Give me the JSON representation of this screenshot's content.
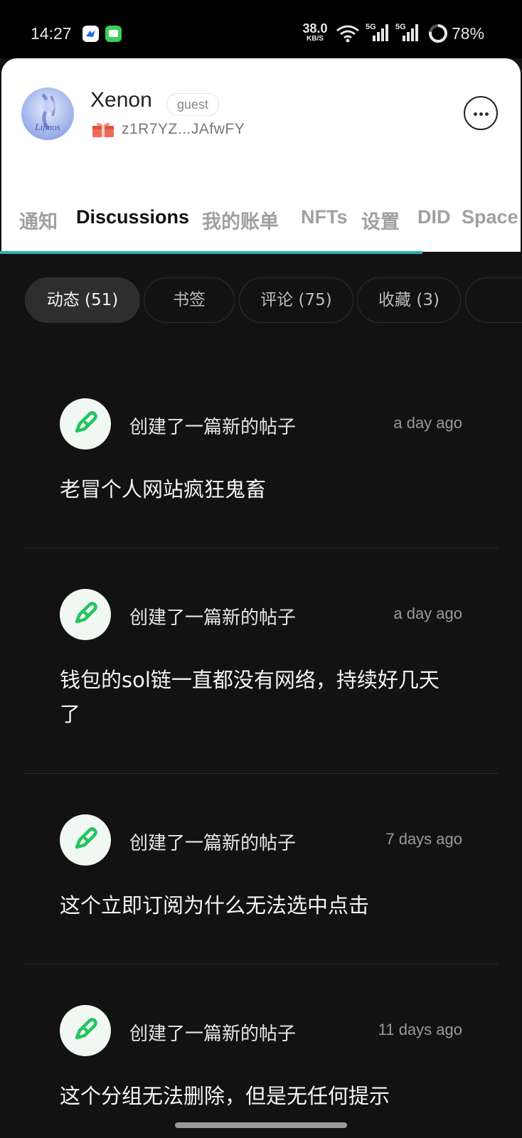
{
  "status_bar": {
    "time": "14:27",
    "net_speed_value": "38.0",
    "net_speed_unit": "KB/S",
    "signal_1_label": "5G",
    "signal_2_label": "5G",
    "battery": "78%",
    "battery_level": 0.78
  },
  "profile": {
    "name": "Xenon",
    "role_badge": "guest",
    "address": "z1R7YZ...JAfwFY",
    "avatar_text": "Lifmos"
  },
  "tabs": [
    "通知",
    "Discussions",
    "我的账单",
    "NFTs",
    "设置",
    "DID",
    "Space"
  ],
  "active_tab": "Discussions",
  "filters": [
    "动态 (51)",
    "书签",
    "评论 (75)",
    "收藏 (3)"
  ],
  "active_filter": "动态 (51)",
  "posts": [
    {
      "action": "创建了一篇新的帖子",
      "time": "a day ago",
      "text": "老冒个人网站疯狂鬼畜"
    },
    {
      "action": "创建了一篇新的帖子",
      "time": "a day ago",
      "text": "钱包的sol链一直都没有网络，持续好几天了"
    },
    {
      "action": "创建了一篇新的帖子",
      "time": "7 days ago",
      "text": "这个立即订阅为什么无法选中点击"
    },
    {
      "action": "创建了一篇新的帖子",
      "time": "11 days ago",
      "text": "这个分组无法删除，但是无任何提示"
    }
  ],
  "colors": {
    "accent": "#2bb5ad",
    "post_icon": "#22c55e",
    "background": "#121212"
  },
  "icons": {
    "post_icon": "link-pen-icon",
    "more": "more-horizontal-icon",
    "gift": "gift-icon"
  }
}
